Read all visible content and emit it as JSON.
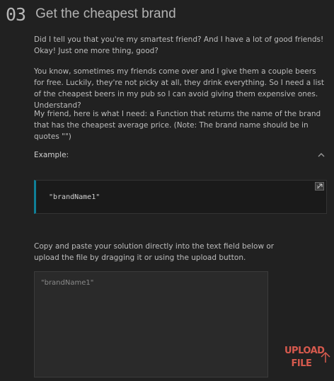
{
  "task": {
    "number": "03",
    "title": "Get the cheapest brand"
  },
  "description": {
    "p1": "Did I tell you that you're my smartest friend? And I have a lot of good friends! Okay! Just one more thing, good?",
    "p2": "You know, sometimes my friends come over and I give them a couple beers for free. Luckily, they're not picky at all, they drink everything. So I need a list of the cheapest beers in my pub so I can avoid giving them expensive ones. Understand?",
    "p3": "My friend, here is what I need: a Function that returns the name of the brand that has the cheapest average price. (Note: The brand name should be in quotes \"\")"
  },
  "example": {
    "title": "Example:",
    "code": "\"brandName1\"",
    "toggle_icon": "chevron-up-icon",
    "copy_icon": "copy-icon"
  },
  "submission": {
    "instructions": "Copy and paste your solution directly into the text field below or upload the file by dragging it or using the upload button.",
    "placeholder": "\"brandName1\"",
    "value": "",
    "upload_label": "UPLOAD FILE",
    "upload_icon": "arrow-up-icon"
  },
  "colors": {
    "background": "#212121",
    "accent": "#d85a4e",
    "example_border": "#0f7f97",
    "field_background": "#2a2a2a"
  }
}
